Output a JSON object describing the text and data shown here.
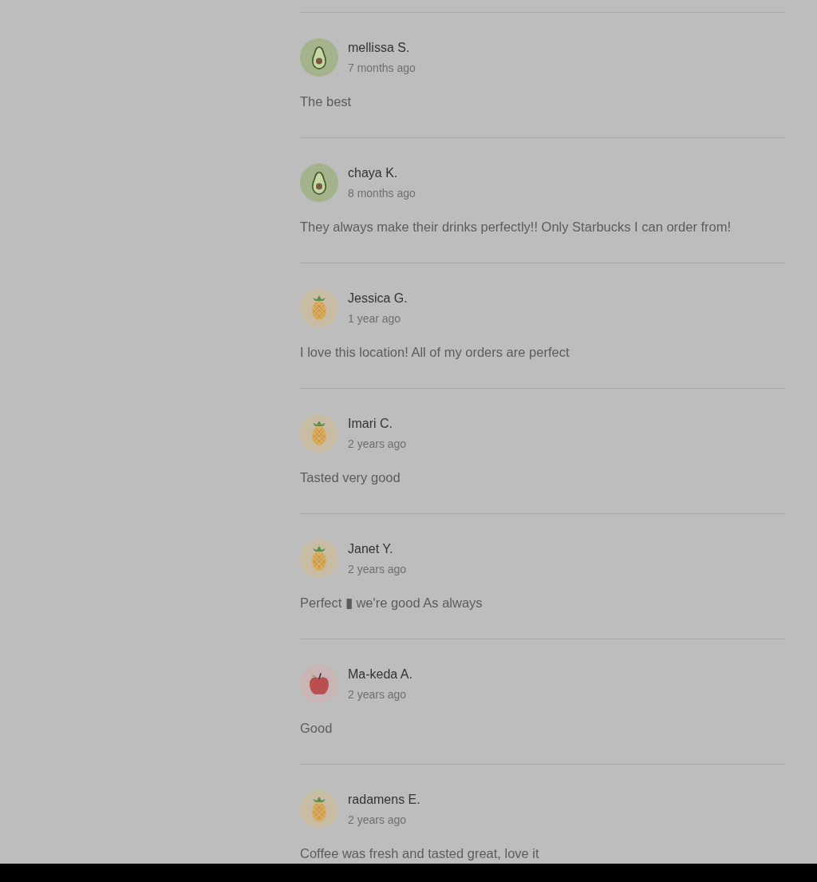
{
  "reviews": [
    {
      "avatar": {
        "kind": "avocado"
      },
      "name": "mellissa S.",
      "time": "7 months ago",
      "text": "The best"
    },
    {
      "avatar": {
        "kind": "avocado"
      },
      "name": "chaya K.",
      "time": "8 months ago",
      "text": "They always make their drinks perfectly!! Only Starbucks I can order from!"
    },
    {
      "avatar": {
        "kind": "pineapple"
      },
      "name": "Jessica G.",
      "time": "1 year ago",
      "text": "I love this location! All of my orders are perfect"
    },
    {
      "avatar": {
        "kind": "pineapple"
      },
      "name": "Imari C.",
      "time": "2 years ago",
      "text": "Tasted very good"
    },
    {
      "avatar": {
        "kind": "pineapple"
      },
      "name": "Janet Y.",
      "time": "2 years ago",
      "text": "Perfect ▮ we're good As always"
    },
    {
      "avatar": {
        "kind": "apple"
      },
      "name": "Ma-keda A.",
      "time": "2 years ago",
      "text": "Good"
    },
    {
      "avatar": {
        "kind": "pineapple"
      },
      "name": "radamens E.",
      "time": "2 years ago",
      "text": "Coffee was fresh and tasted great, love it"
    }
  ]
}
